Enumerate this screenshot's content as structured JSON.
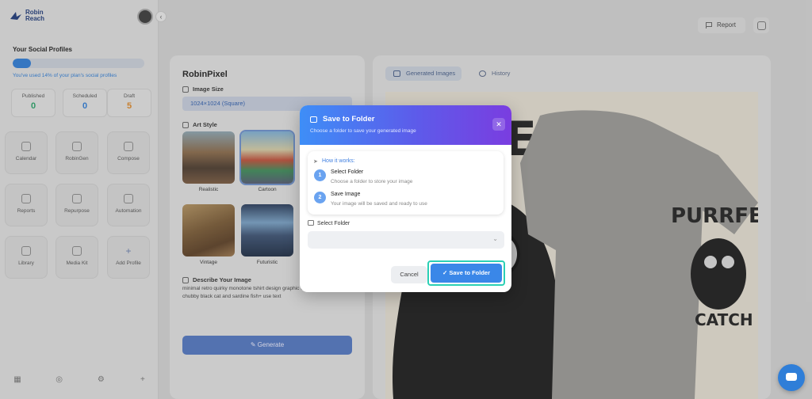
{
  "sidebar": {
    "brand": "Robin Reach",
    "profiles_title": "Your Social Profiles",
    "usage_progress": 0.14,
    "usage_note": "You've used 14% of your plan's social profiles",
    "stats": [
      {
        "label": "Published",
        "value": "0",
        "color": "#2aa56a"
      },
      {
        "label": "Scheduled",
        "value": "0",
        "color": "#2f7ed8"
      },
      {
        "label": "Draft",
        "value": "5",
        "color": "#e08a2a"
      }
    ],
    "tiles": [
      "Calendar",
      "RobinGen",
      "Compose",
      "Reports",
      "Repurpose",
      "Automation",
      "Library",
      "Media Kit",
      "Add Profile"
    ],
    "bottom_icons": [
      "grid-icon",
      "palette-icon",
      "settings-icon",
      "plus-icon"
    ]
  },
  "header": {
    "report_label": "Report"
  },
  "robinpixel": {
    "title": "RobinPixel",
    "image_size_label": "Image Size",
    "image_size_value": "1024×1024 (Square)",
    "art_style_label": "Art Style",
    "styles": [
      {
        "label": "Realistic",
        "selected": false
      },
      {
        "label": "Cartoon",
        "selected": true
      },
      {
        "label": "Vintage",
        "selected": false
      },
      {
        "label": "Futuristic",
        "selected": false
      }
    ],
    "describe_label": "Describe Your Image",
    "prompt": "minimal retro quirky monotone tshirt design graphic of a handrawn style chubby black cat and sardine fish+ use text",
    "generate_label": "Generate"
  },
  "results": {
    "tabs": [
      "Generated Images",
      "History"
    ],
    "shirt_text_top": "ECT",
    "shirt_text_purr": "PURRFEC",
    "shirt_text_catch": "CATCH"
  },
  "modal": {
    "title": "Save to Folder",
    "subtitle": "Choose a folder to save your generated image",
    "how_title": "How it works:",
    "steps": [
      {
        "num": "1",
        "title": "Select Folder",
        "desc": "Choose a folder to store your image"
      },
      {
        "num": "2",
        "title": "Save Image",
        "desc": "Your image will be saved and ready to use"
      }
    ],
    "select_label": "Select Folder",
    "cancel_label": "Cancel",
    "save_label": "Save to Folder"
  }
}
